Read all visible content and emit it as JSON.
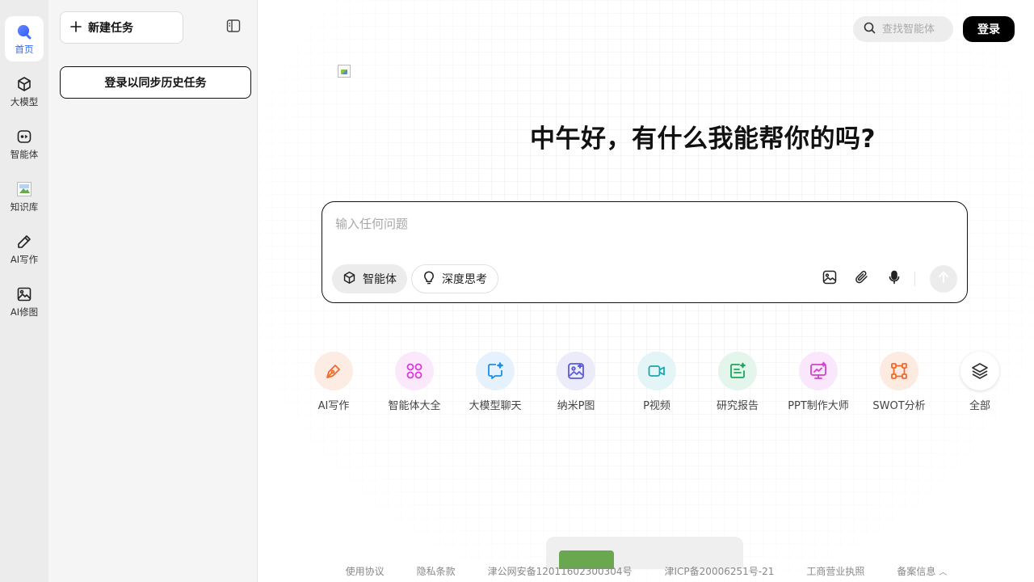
{
  "rail": {
    "items": [
      {
        "label": "首页",
        "icon": "home-icon",
        "active": true
      },
      {
        "label": "大模型",
        "icon": "cube-icon"
      },
      {
        "label": "智能体",
        "icon": "agent-icon"
      },
      {
        "label": "知识库",
        "icon": "knowledge-image-icon"
      },
      {
        "label": "AI写作",
        "icon": "pen-icon"
      },
      {
        "label": "AI修图",
        "icon": "image-icon"
      }
    ]
  },
  "sidebar": {
    "new_task_label": "新建任务",
    "login_sync_label": "登录以同步历史任务"
  },
  "header": {
    "search_placeholder": "查找智能体",
    "login_label": "登录"
  },
  "main": {
    "greeting": "中午好，有什么我能帮你的吗?",
    "composer": {
      "placeholder": "输入任何问题",
      "agent_chip": "智能体",
      "think_chip": "深度思考"
    },
    "shortcuts": [
      {
        "label": "AI写作",
        "icon": "pen-icon",
        "color": "#f26b2a",
        "bg": "#fdece3"
      },
      {
        "label": "智能体大全",
        "icon": "grid-circles-icon",
        "color": "#d93ad9",
        "bg": "#fbe8fb"
      },
      {
        "label": "大模型聊天",
        "icon": "chat-sparkle-icon",
        "color": "#1e8fe8",
        "bg": "#e5f2fd"
      },
      {
        "label": "纳米P图",
        "icon": "image-edit-icon",
        "color": "#5b5bd6",
        "bg": "#ebebfa"
      },
      {
        "label": "P视频",
        "icon": "video-icon",
        "color": "#19a7b0",
        "bg": "#e3f5f6"
      },
      {
        "label": "研究报告",
        "icon": "report-icon",
        "color": "#1aa85c",
        "bg": "#e4f5eb"
      },
      {
        "label": "PPT制作大师",
        "icon": "presentation-icon",
        "color": "#d33fd3",
        "bg": "#fbe7fb"
      },
      {
        "label": "SWOT分析",
        "icon": "swot-icon",
        "color": "#f06a2a",
        "bg": "#fdebe2"
      },
      {
        "label": "全部",
        "icon": "layers-icon",
        "color": "#333333",
        "bg": "#ffffff"
      }
    ]
  },
  "footer": {
    "links": [
      "使用协议",
      "隐私条款",
      "津公网安备12011602300304号",
      "津ICP备20006251号-21",
      "工商营业执照",
      "备案信息"
    ]
  }
}
